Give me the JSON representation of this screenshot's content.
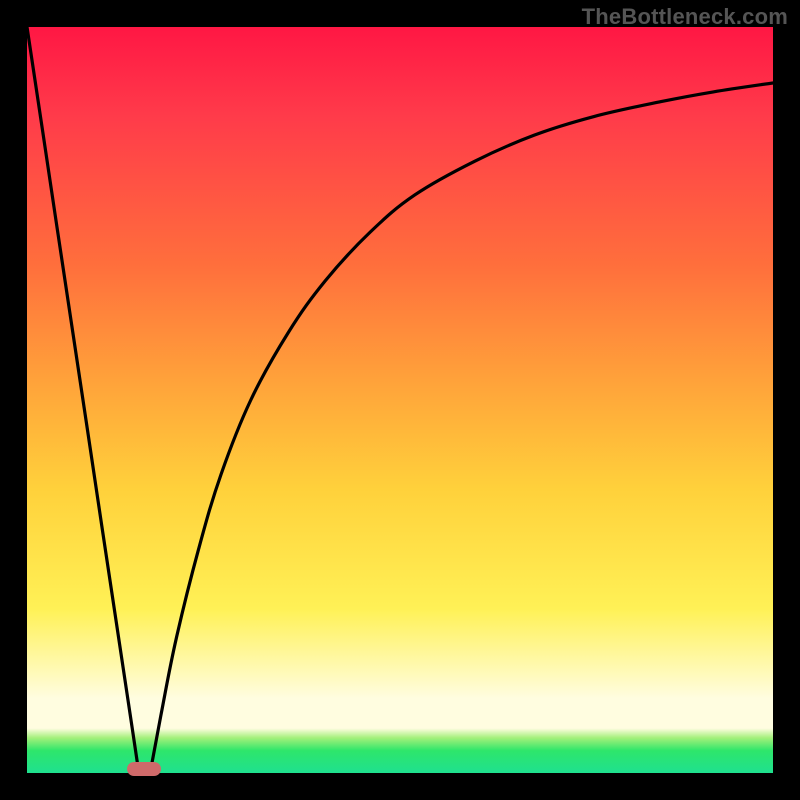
{
  "watermark": "TheBottleneck.com",
  "colors": {
    "frame_bg": "#000000",
    "curve_stroke": "#000000",
    "marker_fill": "#cf6a6a",
    "gradient_top": "#ff1744",
    "gradient_mid1": "#ffa43a",
    "gradient_mid2": "#fff156",
    "gradient_pale": "#fffde0",
    "gradient_green": "#1fe08f"
  },
  "chart_data": {
    "type": "line",
    "title": "",
    "xlabel": "",
    "ylabel": "",
    "xlim": [
      0,
      100
    ],
    "ylim": [
      0,
      100
    ],
    "grid": false,
    "legend": false,
    "series": [
      {
        "name": "left-branch",
        "x": [
          0.0,
          2.0,
          4.0,
          6.0,
          8.0,
          10.0,
          12.0,
          14.0,
          15.0
        ],
        "y": [
          100.0,
          86.7,
          73.3,
          60.0,
          46.7,
          33.3,
          20.0,
          6.7,
          0.0
        ]
      },
      {
        "name": "right-branch",
        "x": [
          16.5,
          18.0,
          20.0,
          23.0,
          26.0,
          30.0,
          35.0,
          40.0,
          46.0,
          52.0,
          60.0,
          68.0,
          76.0,
          85.0,
          92.0,
          100.0
        ],
        "y": [
          0.0,
          8.0,
          18.0,
          30.0,
          40.0,
          50.0,
          59.0,
          66.0,
          72.5,
          77.5,
          82.0,
          85.5,
          88.0,
          90.0,
          91.3,
          92.5
        ]
      }
    ],
    "marker": {
      "x": 15.7,
      "y": 0.6,
      "shape": "rounded-pill"
    },
    "background_gradient": {
      "direction": "vertical",
      "stops": [
        {
          "pos": 0.0,
          "color": "#ff1744"
        },
        {
          "pos": 0.32,
          "color": "#ff6f3c"
        },
        {
          "pos": 0.62,
          "color": "#ffd13b"
        },
        {
          "pos": 0.9,
          "color": "#fffde0"
        },
        {
          "pos": 0.97,
          "color": "#2ee66b"
        },
        {
          "pos": 1.0,
          "color": "#1fe08f"
        }
      ]
    }
  }
}
